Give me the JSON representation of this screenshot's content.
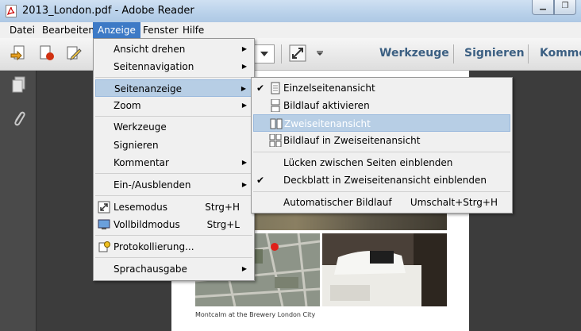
{
  "window": {
    "title": "2013_London.pdf - Adobe Reader",
    "minimize": "▁",
    "restore": "❐"
  },
  "menubar": [
    "Datei",
    "Bearbeiten",
    "Anzeige",
    "Fenster",
    "Hilfe"
  ],
  "toolbar": {
    "links": [
      "Werkzeuge",
      "Signieren",
      "Kommer"
    ]
  },
  "anzeige_menu": [
    {
      "label": "Ansicht drehen"
    },
    {
      "label": "Seitennavigation"
    },
    {
      "label": "Seitenanzeige"
    },
    {
      "label": "Zoom"
    },
    {
      "label": "Werkzeuge"
    },
    {
      "label": "Signieren"
    },
    {
      "label": "Kommentar"
    },
    {
      "label": "Ein-/Ausblenden"
    },
    {
      "label": "Lesemodus",
      "shortcut": "Strg+H"
    },
    {
      "label": "Vollbildmodus",
      "shortcut": "Strg+L"
    },
    {
      "label": "Protokollierung..."
    },
    {
      "label": "Sprachausgabe"
    }
  ],
  "seitenanzeige_menu": [
    {
      "label": "Einzelseitenansicht"
    },
    {
      "label": "Bildlauf aktivieren"
    },
    {
      "label": "Zweiseitenansicht"
    },
    {
      "label": "Bildlauf in Zweiseitenansicht"
    },
    {
      "label": "Lücken zwischen Seiten einblenden"
    },
    {
      "label": "Deckblatt in Zweiseitenansicht einblenden"
    },
    {
      "label": "Automatischer Bildlauf",
      "shortcut": "Umschalt+Strg+H"
    }
  ],
  "document": {
    "caption": "Montcalm at the Brewery London City"
  },
  "colors": {
    "menu_active": "#3d7ac6",
    "menu_highlight": "#b7cee5",
    "toolbar_link": "#3b5f82"
  }
}
